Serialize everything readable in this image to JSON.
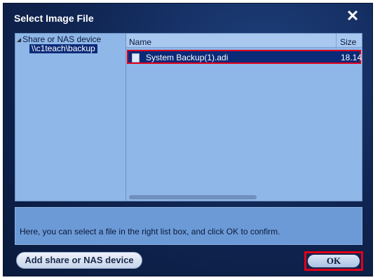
{
  "window": {
    "title": "Select Image File",
    "close_icon": "close-icon"
  },
  "tree": {
    "root_label": "Share or NAS device",
    "children": [
      {
        "label": "\\\\c1teach\\backup",
        "selected": true
      }
    ]
  },
  "file_list": {
    "columns": [
      "Name",
      "Size"
    ],
    "rows": [
      {
        "name": "System Backup(1).adi",
        "size": "18.14",
        "selected": true,
        "icon": "file-icon"
      }
    ]
  },
  "info": {
    "text": "Here, you can select a file in the right list box, and click OK to confirm."
  },
  "buttons": {
    "add_label": "Add share or NAS device",
    "ok_label": "OK"
  },
  "colors": {
    "background": "#0f2450",
    "pane": "#8fb7e8",
    "selection": "#0b2a78",
    "highlight_border": "#e0001a"
  }
}
